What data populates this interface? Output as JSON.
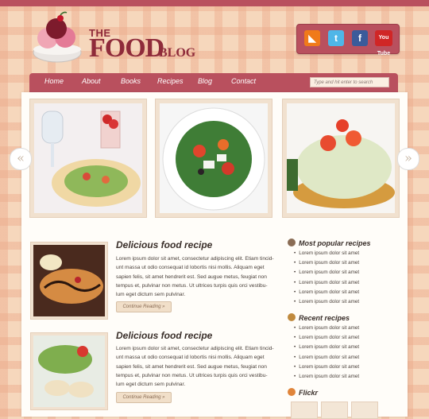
{
  "logo": {
    "the": "THE",
    "food": "FOOD",
    "blog": "BLOG"
  },
  "social": [
    {
      "name": "rss-icon",
      "glyph": "◣"
    },
    {
      "name": "twitter-icon",
      "glyph": "t"
    },
    {
      "name": "facebook-icon",
      "glyph": "f"
    },
    {
      "name": "youtube-icon",
      "glyph": "You Tube"
    }
  ],
  "nav": [
    "Home",
    "About",
    "Books",
    "Recipes",
    "Blog",
    "Contact"
  ],
  "search": {
    "placeholder": "Type and hit enter to search"
  },
  "slider": {
    "prev": "«",
    "next": "»"
  },
  "posts": [
    {
      "title": "Delicious food recipe",
      "lines": [
        "Lorem ipsum dolor sit amet, consectetur adipiscing elit. Etiam tincid-",
        "unt massa ut odio consequat id lobortis nisi mollis. Aliquam eget",
        "sapien felis, sit amet hendrerit est. Sed augue metus, feugiat non",
        "tempus et, pulvinar non metus. Ut ultrices turpis quis orci vestibu-",
        "lum eget dictum sem pulvinar."
      ],
      "more": "Continue Reading »"
    },
    {
      "title": "Delicious food recipe",
      "lines": [
        "Lorem ipsum dolor sit amet, consectetur adipiscing elit. Etiam tincid-",
        "unt massa ut odio consequat id lobortis nisi mollis. Aliquam eget",
        "sapien felis, sit amet hendrerit est. Sed augue metus, feugiat non",
        "tempus et, pulvinar non metus. Ut ultrices turpis quis orci vestibu-",
        "lum eget dictum sem pulvinar."
      ],
      "more": "Continue Reading »"
    }
  ],
  "sidebar": {
    "popular": {
      "title": "Most popular recipes",
      "items": [
        "Lorem ipsum dolor sit amet",
        "Lorem ipsum dolor sit amet",
        "Lorem ipsum dolor sit amet",
        "Lorem ipsum dolor sit amet",
        "Lorem ipsum dolor sit amet",
        "Lorem ipsum dolor sit amet"
      ]
    },
    "recent": {
      "title": "Recent recipes",
      "items": [
        "Lorem ipsum dolor sit amet",
        "Lorem ipsum dolor sit amet",
        "Lorem ipsum dolor sit amet",
        "Lorem ipsum dolor sit amet",
        "Lorem ipsum dolor sit amet",
        "Lorem ipsum dolor sit amet"
      ]
    },
    "flickr": {
      "title": "Flickr"
    }
  },
  "colors": {
    "accent": "#b9505e",
    "brand": "#8f2b3a",
    "background": "#f6d7bc"
  }
}
